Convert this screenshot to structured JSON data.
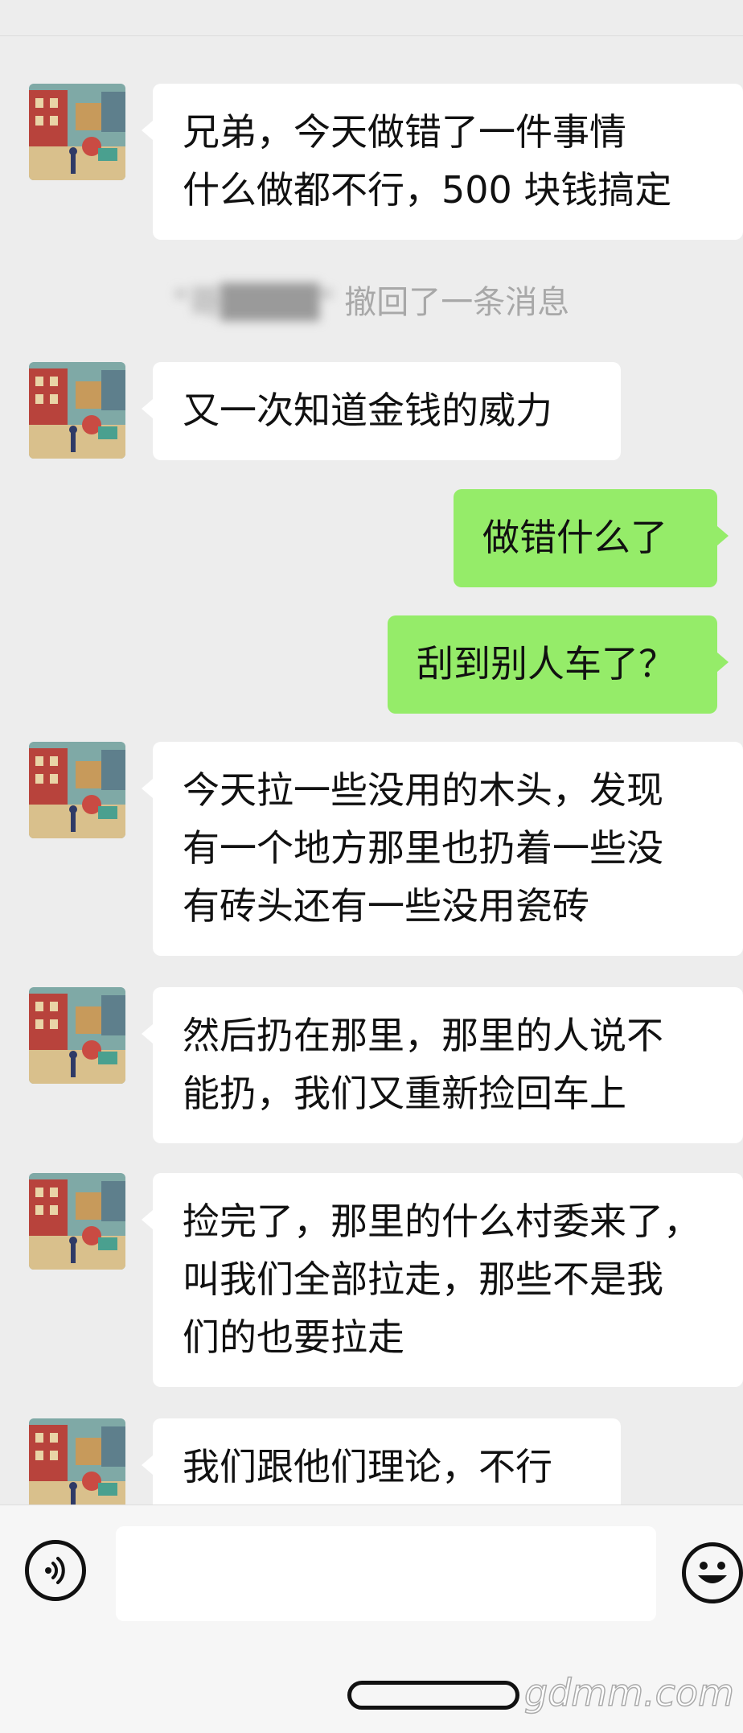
{
  "messages": [
    {
      "side": "in",
      "text": "兄弟，今天做错了一件事情\n什么做都不行，500 块钱搞定"
    },
    {
      "side": "system",
      "name_blurred": "\"哥████\"",
      "text": " 撤回了一条消息"
    },
    {
      "side": "in",
      "text": "又一次知道金钱的威力"
    },
    {
      "side": "out",
      "text": "做错什么了"
    },
    {
      "side": "out",
      "text": "刮到别人车了？"
    },
    {
      "side": "in",
      "text": "今天拉一些没用的木头，发现\n有一个地方那里也扔着一些没\n有砖头还有一些没用瓷砖"
    },
    {
      "side": "in",
      "text": "然后扔在那里，那里的人说不\n能扔，我们又重新捡回车上"
    },
    {
      "side": "in",
      "text": "捡完了，那里的什么村委来了，\n叫我们全部拉走，那些不是我\n们的也要拉走"
    },
    {
      "side": "in",
      "text": "我们跟他们理论，不行"
    }
  ],
  "input_bar": {
    "voice_icon": "voice-icon",
    "emoji_icon": "emoji-icon",
    "input_value": ""
  },
  "watermark": "gdmm.com",
  "colors": {
    "background": "#ededed",
    "incoming_bubble": "#ffffff",
    "outgoing_bubble": "#95ec69",
    "system_text": "#a8a8a8"
  }
}
